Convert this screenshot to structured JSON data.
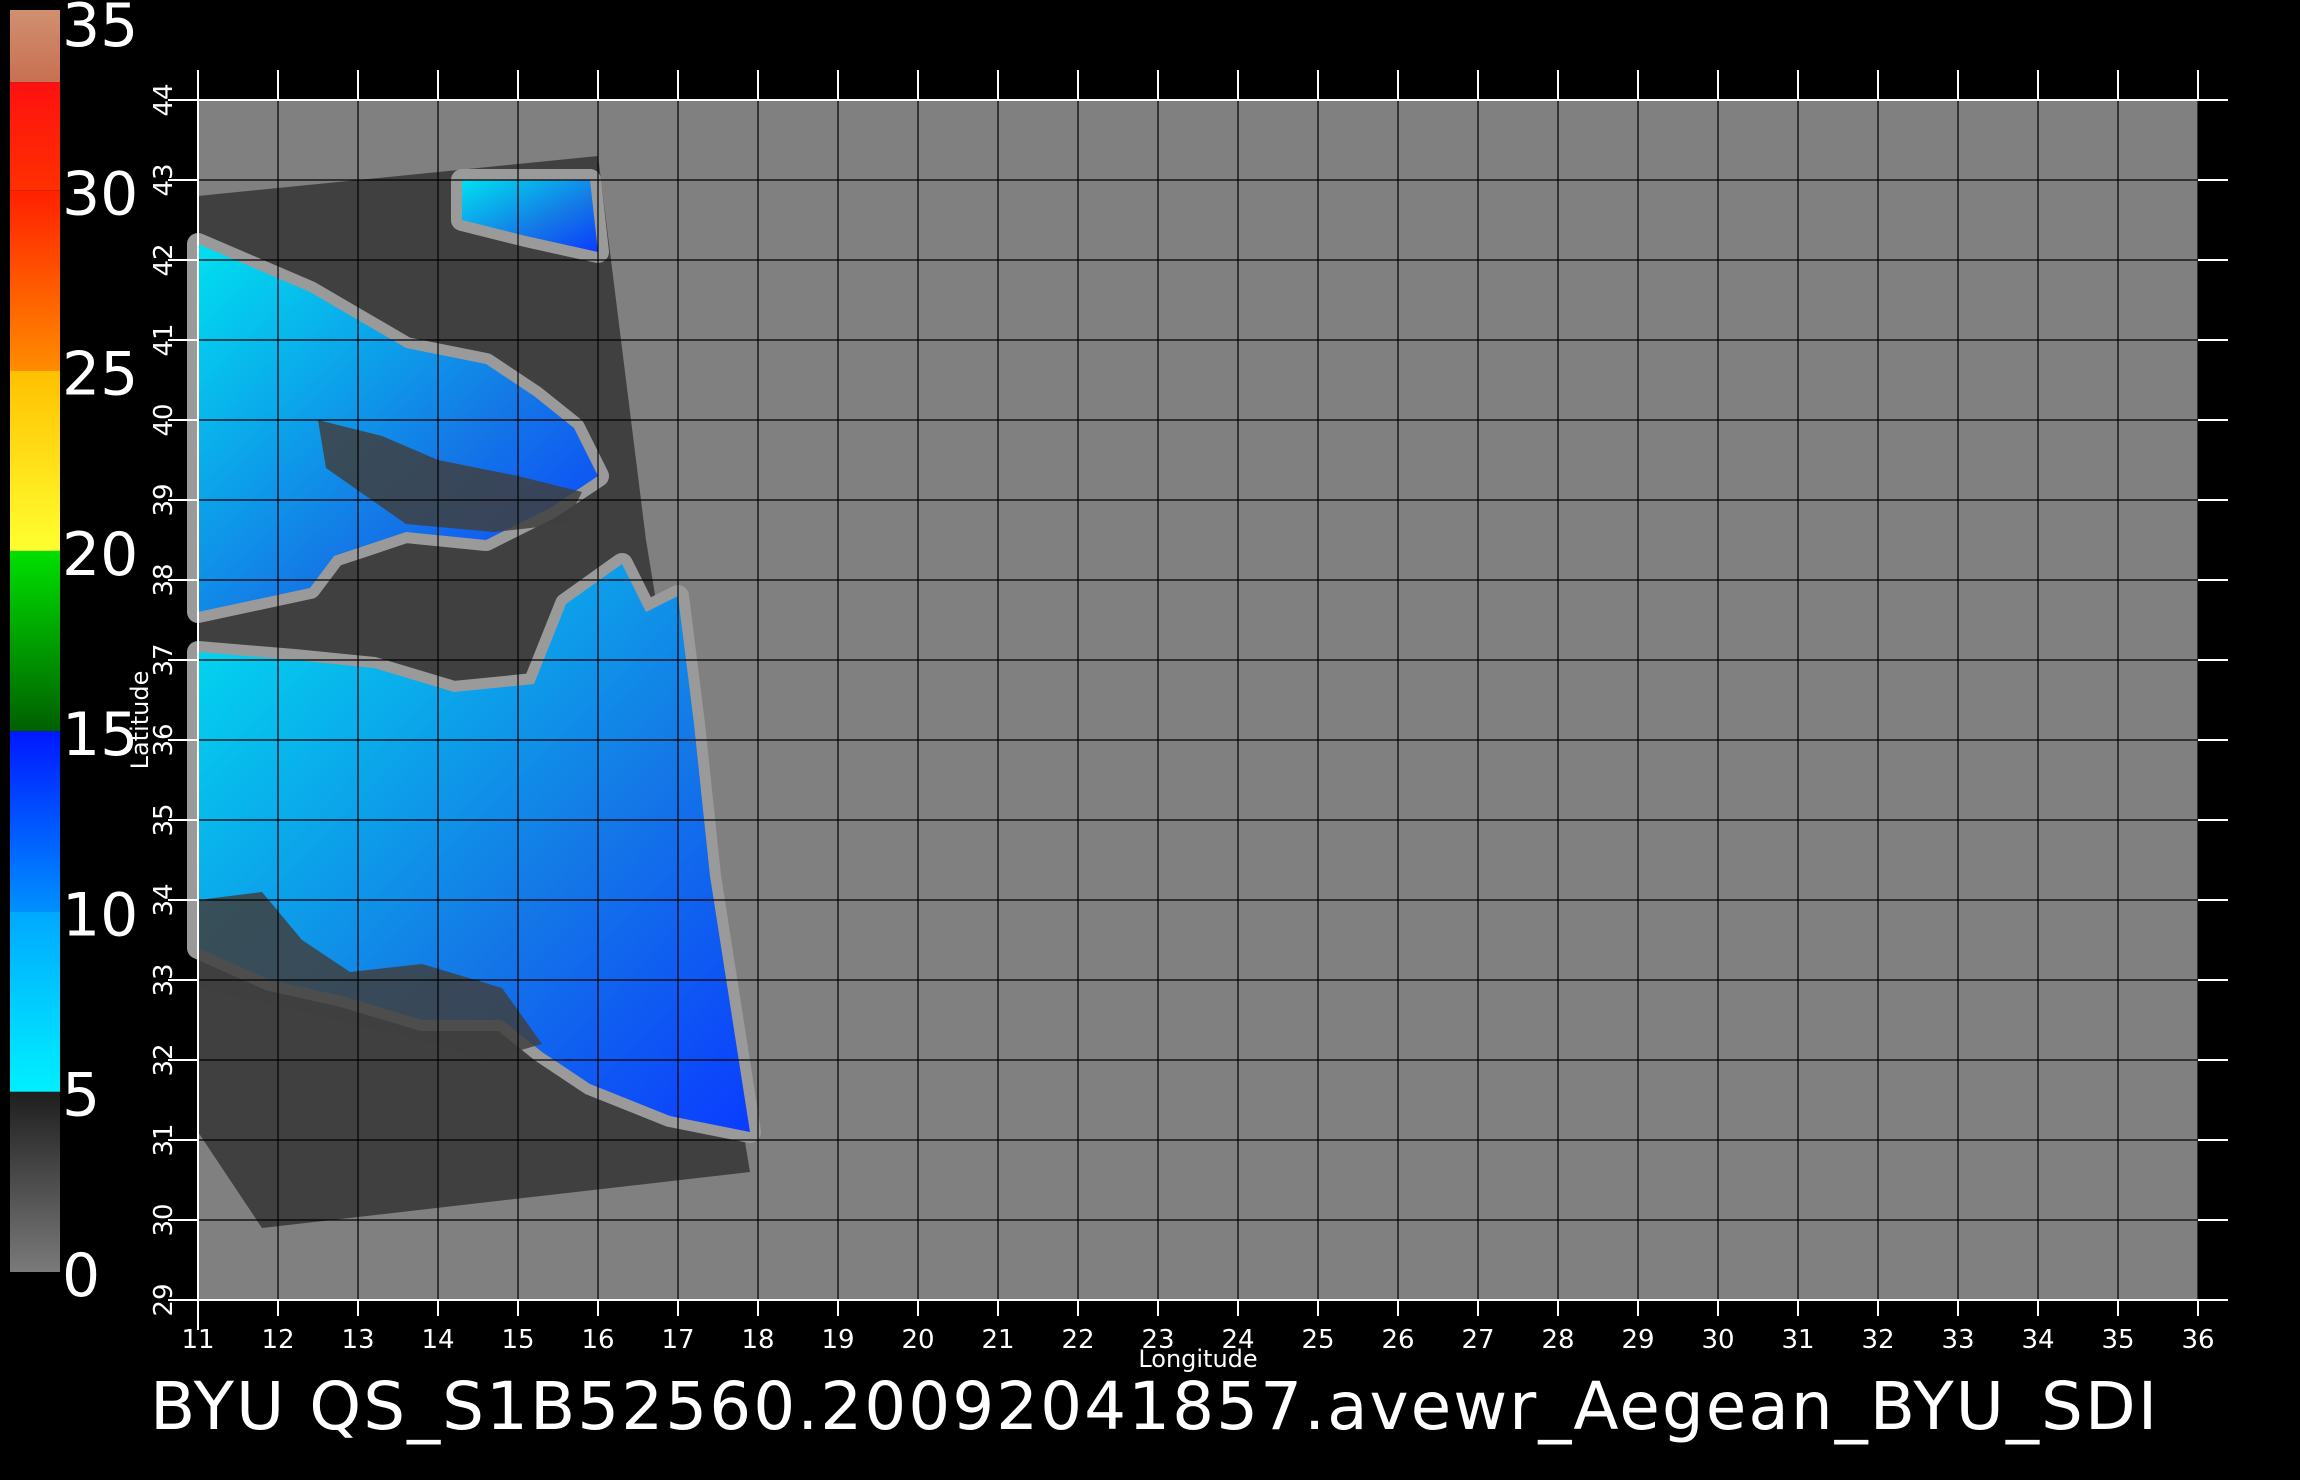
{
  "caption": "BYU QS_S1B52560.20092041857.avewr_Aegean_BYU_SDI",
  "colorbar": {
    "ticks": [
      "0",
      "5",
      "10",
      "15",
      "20",
      "25",
      "30",
      "35"
    ],
    "segments": [
      {
        "from": 0,
        "to": 5,
        "colors": [
          "#7a7a7a",
          "#1e1e1e"
        ]
      },
      {
        "from": 5,
        "to": 10,
        "colors": [
          "#00f0ff",
          "#00a8ff"
        ]
      },
      {
        "from": 10,
        "to": 15,
        "colors": [
          "#0090ff",
          "#0018ff"
        ]
      },
      {
        "from": 15,
        "to": 20,
        "colors": [
          "#006000",
          "#00e000"
        ]
      },
      {
        "from": 20,
        "to": 25,
        "colors": [
          "#ffff30",
          "#ffc000"
        ]
      },
      {
        "from": 25,
        "to": 30,
        "colors": [
          "#ff8c00",
          "#ff2000"
        ]
      },
      {
        "from": 30,
        "to": 33,
        "colors": [
          "#ff3000",
          "#ff1010"
        ]
      },
      {
        "from": 33,
        "to": 35,
        "colors": [
          "#c87050",
          "#d09070"
        ]
      }
    ]
  },
  "map": {
    "lon_label": "Longitude",
    "lat_label": "Latitude",
    "lon_range": [
      11,
      36
    ],
    "lat_range": [
      29,
      44
    ],
    "lon_ticks": [
      "11",
      "12",
      "13",
      "14",
      "15",
      "16",
      "17",
      "18",
      "19",
      "20",
      "21",
      "22",
      "23",
      "24",
      "25",
      "26",
      "27",
      "28",
      "29",
      "30",
      "31",
      "32",
      "33",
      "34",
      "35",
      "36"
    ],
    "lat_ticks": [
      "29",
      "30",
      "31",
      "32",
      "33",
      "34",
      "35",
      "36",
      "37",
      "38",
      "39",
      "40",
      "41",
      "42",
      "43",
      "44"
    ],
    "colors": {
      "background": "#808080",
      "swath": "#404040",
      "coast_band": "#9a9a9a",
      "ocean": "#1478e6",
      "ocean_light": "#00e0f0",
      "grid": "#000000"
    },
    "swath": [
      [
        11,
        42.8
      ],
      [
        16,
        43.3
      ],
      [
        16.6,
        38.5
      ],
      [
        17.8,
        31.2
      ],
      [
        17.9,
        30.6
      ],
      [
        11.8,
        29.9
      ],
      [
        11,
        31.1
      ]
    ],
    "swath_top": [
      [
        14.1,
        43.0
      ],
      [
        16.0,
        43.0
      ],
      [
        16.0,
        42.0
      ],
      [
        14.1,
        42.0
      ]
    ],
    "ocean_regions": [
      [
        [
          11,
          42.2
        ],
        [
          12.4,
          41.6
        ],
        [
          13.6,
          40.9
        ],
        [
          14.6,
          40.7
        ],
        [
          15.2,
          40.3
        ],
        [
          15.7,
          39.9
        ],
        [
          16.0,
          39.3
        ],
        [
          15.4,
          38.9
        ],
        [
          14.6,
          38.5
        ],
        [
          13.6,
          38.6
        ],
        [
          12.7,
          38.3
        ],
        [
          12.4,
          37.9
        ],
        [
          11,
          37.6
        ]
      ],
      [
        [
          11,
          37.1
        ],
        [
          12.2,
          37.0
        ],
        [
          13.2,
          36.9
        ],
        [
          14.2,
          36.6
        ],
        [
          15.2,
          36.7
        ],
        [
          15.6,
          37.7
        ],
        [
          16.3,
          38.2
        ],
        [
          16.6,
          37.6
        ],
        [
          17.0,
          37.8
        ],
        [
          17.2,
          36.2
        ],
        [
          17.4,
          34.3
        ],
        [
          17.9,
          31.1
        ],
        [
          16.9,
          31.3
        ],
        [
          15.9,
          31.7
        ],
        [
          15.3,
          32.1
        ],
        [
          14.8,
          32.5
        ],
        [
          13.8,
          32.5
        ],
        [
          12.8,
          32.8
        ],
        [
          11.9,
          33.0
        ],
        [
          11,
          33.4
        ]
      ],
      [
        [
          14.3,
          43.0
        ],
        [
          15.9,
          43.0
        ],
        [
          16.0,
          42.1
        ],
        [
          15.1,
          42.3
        ],
        [
          14.3,
          42.5
        ]
      ]
    ],
    "land_regions": [
      [
        [
          12.5,
          40.0
        ],
        [
          13.3,
          39.8
        ],
        [
          14.0,
          39.5
        ],
        [
          15.0,
          39.3
        ],
        [
          15.8,
          39.1
        ],
        [
          15.6,
          38.7
        ],
        [
          14.7,
          38.6
        ],
        [
          13.6,
          38.7
        ],
        [
          12.6,
          39.4
        ]
      ],
      [
        [
          11.0,
          34.0
        ],
        [
          11.8,
          34.1
        ],
        [
          12.3,
          33.5
        ],
        [
          12.9,
          33.1
        ],
        [
          13.8,
          33.2
        ],
        [
          14.8,
          32.9
        ],
        [
          15.3,
          32.2
        ],
        [
          14.6,
          32.0
        ],
        [
          13.6,
          32.3
        ],
        [
          12.3,
          32.6
        ],
        [
          11.0,
          32.9
        ]
      ]
    ]
  }
}
